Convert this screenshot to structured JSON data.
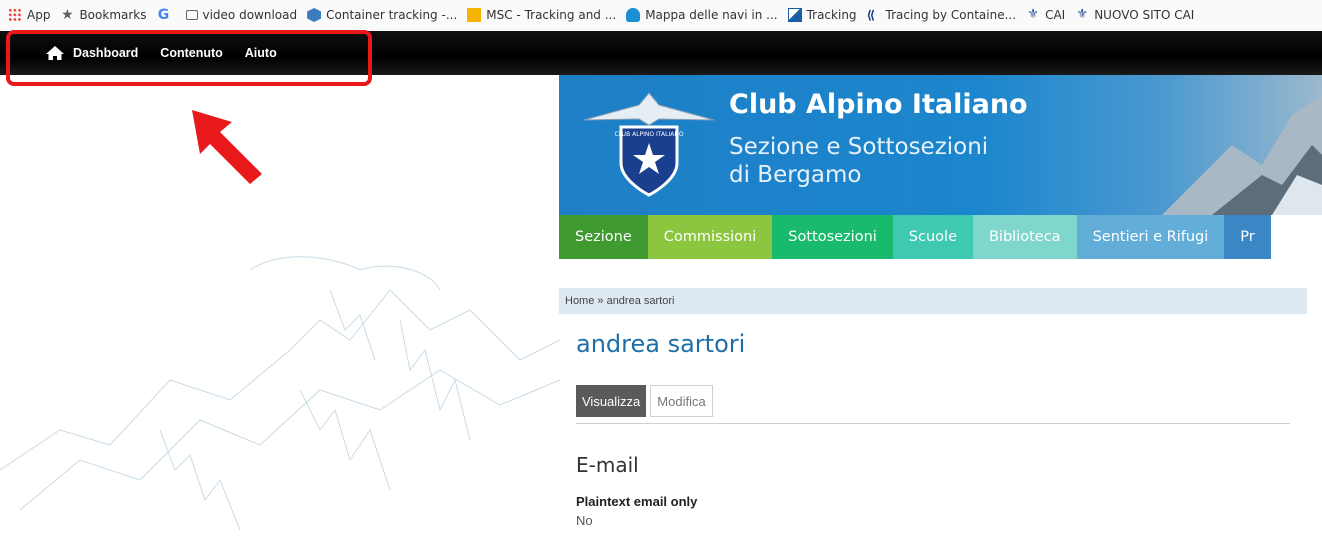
{
  "bookmarks": [
    {
      "label": "App",
      "icon": "apps-grid-icon"
    },
    {
      "label": "Bookmarks",
      "icon": "star-icon"
    },
    {
      "label": "",
      "icon": "google-icon"
    },
    {
      "label": "video download",
      "icon": "folder-icon"
    },
    {
      "label": "Container tracking -...",
      "icon": "cube-icon"
    },
    {
      "label": "MSC - Tracking and ...",
      "icon": "msc-icon"
    },
    {
      "label": "Mappa delle navi in ...",
      "icon": "ship-icon"
    },
    {
      "label": "Tracking",
      "icon": "tracking-icon"
    },
    {
      "label": "Tracing by Containe...",
      "icon": "tbc-icon"
    },
    {
      "label": "CAI",
      "icon": "cai-icon"
    },
    {
      "label": "NUOVO SITO CAI",
      "icon": "cai-icon"
    }
  ],
  "toolbar": {
    "home_icon": "home-icon",
    "items": [
      "Dashboard",
      "Contenuto",
      "Aiuto"
    ]
  },
  "annotation": {
    "highlight_color": "#e8181b",
    "arrow_color": "#e8181b"
  },
  "header": {
    "title": "Club Alpino Italiano",
    "subtitle_line1": "Sezione e Sottosezioni",
    "subtitle_line2": "di Bergamo",
    "logo_text": "CLUB ALPINO ITALIANO"
  },
  "nav": [
    {
      "label": "Sezione",
      "color": "#3f9a2f"
    },
    {
      "label": "Commissioni",
      "color": "#8cc63f"
    },
    {
      "label": "Sottosezioni",
      "color": "#1aba6e"
    },
    {
      "label": "Scuole",
      "color": "#3ec9b0"
    },
    {
      "label": "Biblioteca",
      "color": "#7fd6cc"
    },
    {
      "label": "Sentieri e Rifugi",
      "color": "#63aed8"
    },
    {
      "label": "Pr",
      "color": "#3b86c4"
    }
  ],
  "breadcrumb": "Home » andrea sartori",
  "page_title": "andrea sartori",
  "tabs": [
    "Visualizza",
    "Modifica"
  ],
  "section": {
    "heading": "E-mail",
    "field_label": "Plaintext email only",
    "field_value": "No"
  }
}
